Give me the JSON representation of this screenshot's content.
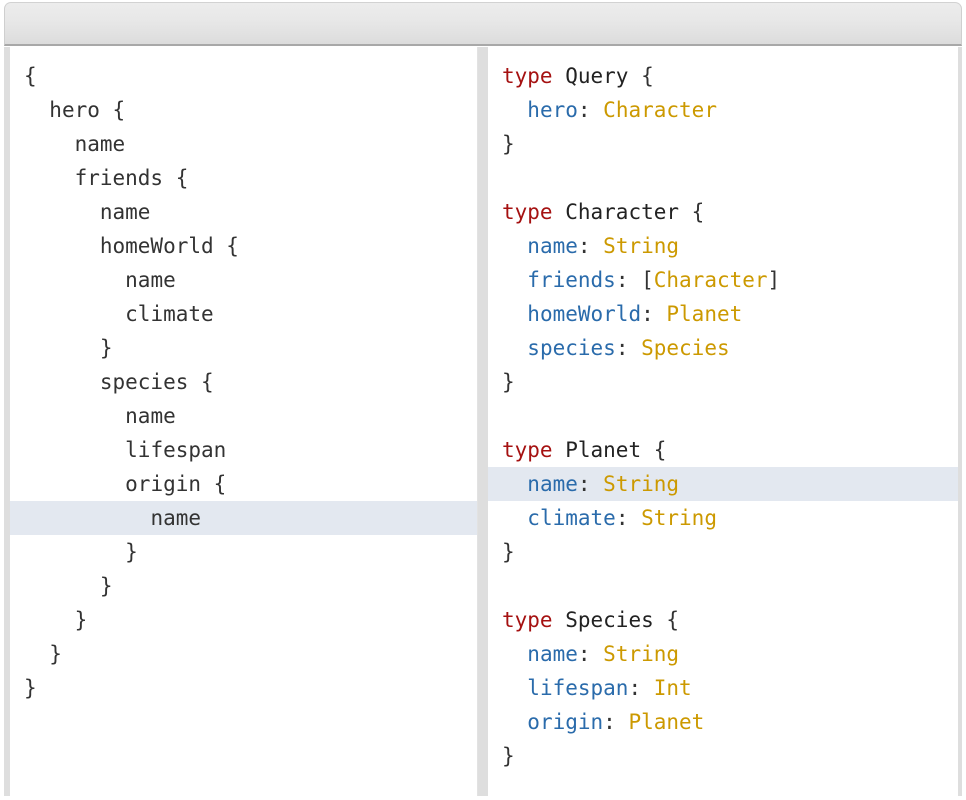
{
  "window": {
    "title": ""
  },
  "left_pane": {
    "name": "graphql-query-editor",
    "language": "graphql-query",
    "lines": [
      {
        "indent": 0,
        "tokens": [
          {
            "text": "{",
            "kind": "punc"
          }
        ]
      },
      {
        "indent": 1,
        "tokens": [
          {
            "text": "hero {",
            "kind": "plain"
          }
        ]
      },
      {
        "indent": 2,
        "tokens": [
          {
            "text": "name",
            "kind": "plain"
          }
        ]
      },
      {
        "indent": 2,
        "tokens": [
          {
            "text": "friends {",
            "kind": "plain"
          }
        ]
      },
      {
        "indent": 3,
        "tokens": [
          {
            "text": "name",
            "kind": "plain"
          }
        ]
      },
      {
        "indent": 3,
        "tokens": [
          {
            "text": "homeWorld {",
            "kind": "plain"
          }
        ]
      },
      {
        "indent": 4,
        "tokens": [
          {
            "text": "name",
            "kind": "plain"
          }
        ]
      },
      {
        "indent": 4,
        "tokens": [
          {
            "text": "climate",
            "kind": "plain"
          }
        ]
      },
      {
        "indent": 3,
        "tokens": [
          {
            "text": "}",
            "kind": "punc"
          }
        ]
      },
      {
        "indent": 3,
        "tokens": [
          {
            "text": "species {",
            "kind": "plain"
          }
        ]
      },
      {
        "indent": 4,
        "tokens": [
          {
            "text": "name",
            "kind": "plain"
          }
        ]
      },
      {
        "indent": 4,
        "tokens": [
          {
            "text": "lifespan",
            "kind": "plain"
          }
        ]
      },
      {
        "indent": 4,
        "tokens": [
          {
            "text": "origin {",
            "kind": "plain"
          }
        ]
      },
      {
        "indent": 5,
        "highlight": true,
        "tokens": [
          {
            "text": "name",
            "kind": "plain"
          }
        ]
      },
      {
        "indent": 4,
        "tokens": [
          {
            "text": "}",
            "kind": "punc"
          }
        ]
      },
      {
        "indent": 3,
        "tokens": [
          {
            "text": "}",
            "kind": "punc"
          }
        ]
      },
      {
        "indent": 2,
        "tokens": [
          {
            "text": "}",
            "kind": "punc"
          }
        ]
      },
      {
        "indent": 1,
        "tokens": [
          {
            "text": "}",
            "kind": "punc"
          }
        ]
      },
      {
        "indent": 0,
        "tokens": [
          {
            "text": "}",
            "kind": "punc"
          }
        ]
      }
    ]
  },
  "right_pane": {
    "name": "graphql-schema-viewer",
    "language": "graphql-schema",
    "lines": [
      {
        "indent": 0,
        "tokens": [
          {
            "text": "type",
            "kind": "kw"
          },
          {
            "text": " ",
            "kind": "plain"
          },
          {
            "text": "Query",
            "kind": "type"
          },
          {
            "text": " {",
            "kind": "punc"
          }
        ]
      },
      {
        "indent": 1,
        "tokens": [
          {
            "text": "hero",
            "kind": "field"
          },
          {
            "text": ": ",
            "kind": "punc"
          },
          {
            "text": "Character",
            "kind": "val"
          }
        ]
      },
      {
        "indent": 0,
        "tokens": [
          {
            "text": "}",
            "kind": "punc"
          }
        ]
      },
      {
        "indent": 0,
        "tokens": [
          {
            "text": "",
            "kind": "plain"
          }
        ]
      },
      {
        "indent": 0,
        "tokens": [
          {
            "text": "type",
            "kind": "kw"
          },
          {
            "text": " ",
            "kind": "plain"
          },
          {
            "text": "Character",
            "kind": "type"
          },
          {
            "text": " {",
            "kind": "punc"
          }
        ]
      },
      {
        "indent": 1,
        "tokens": [
          {
            "text": "name",
            "kind": "field"
          },
          {
            "text": ": ",
            "kind": "punc"
          },
          {
            "text": "String",
            "kind": "val"
          }
        ]
      },
      {
        "indent": 1,
        "tokens": [
          {
            "text": "friends",
            "kind": "field"
          },
          {
            "text": ": [",
            "kind": "punc"
          },
          {
            "text": "Character",
            "kind": "val"
          },
          {
            "text": "]",
            "kind": "punc"
          }
        ]
      },
      {
        "indent": 1,
        "tokens": [
          {
            "text": "homeWorld",
            "kind": "field"
          },
          {
            "text": ": ",
            "kind": "punc"
          },
          {
            "text": "Planet",
            "kind": "val"
          }
        ]
      },
      {
        "indent": 1,
        "tokens": [
          {
            "text": "species",
            "kind": "field"
          },
          {
            "text": ": ",
            "kind": "punc"
          },
          {
            "text": "Species",
            "kind": "val"
          }
        ]
      },
      {
        "indent": 0,
        "tokens": [
          {
            "text": "}",
            "kind": "punc"
          }
        ]
      },
      {
        "indent": 0,
        "tokens": [
          {
            "text": "",
            "kind": "plain"
          }
        ]
      },
      {
        "indent": 0,
        "tokens": [
          {
            "text": "type",
            "kind": "kw"
          },
          {
            "text": " ",
            "kind": "plain"
          },
          {
            "text": "Planet",
            "kind": "type"
          },
          {
            "text": " {",
            "kind": "punc"
          }
        ]
      },
      {
        "indent": 1,
        "highlight": true,
        "tokens": [
          {
            "text": "name",
            "kind": "field"
          },
          {
            "text": ": ",
            "kind": "punc"
          },
          {
            "text": "String",
            "kind": "val"
          }
        ]
      },
      {
        "indent": 1,
        "tokens": [
          {
            "text": "climate",
            "kind": "field"
          },
          {
            "text": ": ",
            "kind": "punc"
          },
          {
            "text": "String",
            "kind": "val"
          }
        ]
      },
      {
        "indent": 0,
        "tokens": [
          {
            "text": "}",
            "kind": "punc"
          }
        ]
      },
      {
        "indent": 0,
        "tokens": [
          {
            "text": "",
            "kind": "plain"
          }
        ]
      },
      {
        "indent": 0,
        "tokens": [
          {
            "text": "type",
            "kind": "kw"
          },
          {
            "text": " ",
            "kind": "plain"
          },
          {
            "text": "Species",
            "kind": "type"
          },
          {
            "text": " {",
            "kind": "punc"
          }
        ]
      },
      {
        "indent": 1,
        "tokens": [
          {
            "text": "name",
            "kind": "field"
          },
          {
            "text": ": ",
            "kind": "punc"
          },
          {
            "text": "String",
            "kind": "val"
          }
        ]
      },
      {
        "indent": 1,
        "tokens": [
          {
            "text": "lifespan",
            "kind": "field"
          },
          {
            "text": ": ",
            "kind": "punc"
          },
          {
            "text": "Int",
            "kind": "val"
          }
        ]
      },
      {
        "indent": 1,
        "tokens": [
          {
            "text": "origin",
            "kind": "field"
          },
          {
            "text": ": ",
            "kind": "punc"
          },
          {
            "text": "Planet",
            "kind": "val"
          }
        ]
      },
      {
        "indent": 0,
        "tokens": [
          {
            "text": "}",
            "kind": "punc"
          }
        ]
      }
    ]
  },
  "colors": {
    "keyword": "#a51111",
    "type_name": "#222222",
    "field_name": "#2a6bab",
    "value_type": "#cc9900",
    "plain_text": "#333333",
    "highlight_row": "#e3e8f0",
    "divider": "#dedede",
    "titlebar_top": "#ececec",
    "titlebar_bottom": "#dcdcdc",
    "background": "#ffffff"
  }
}
